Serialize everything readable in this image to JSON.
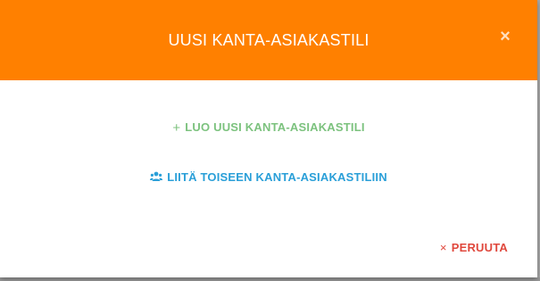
{
  "dialog": {
    "title": "UUSI KANTA-ASIAKASTILI",
    "close_glyph": "×",
    "create_icon": "+",
    "create_label": "LUO UUSI KANTA-ASIAKASTILI",
    "join_icon": "group-icon",
    "join_label": "LIITÄ TOISEEN KANTA-ASIAKASTILIIN",
    "cancel_icon": "×",
    "cancel_label": "PERUUTA"
  },
  "colors": {
    "header": "#ff8000",
    "create": "#7cc27e",
    "join": "#2a9fd8",
    "cancel": "#e0483d"
  }
}
